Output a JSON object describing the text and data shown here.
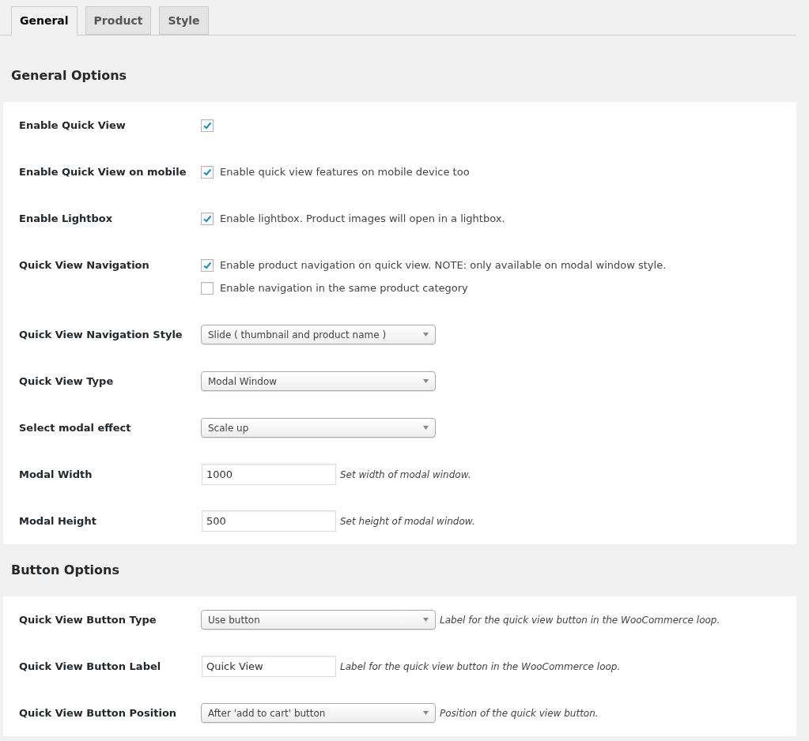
{
  "tabs": [
    {
      "label": "General",
      "selected": true
    },
    {
      "label": "Product",
      "selected": false
    },
    {
      "label": "Style",
      "selected": false
    }
  ],
  "sections": [
    {
      "title": "General Options",
      "rows": [
        {
          "label": "Enable Quick View",
          "kind": "checkboxes",
          "options": [
            {
              "checked": true
            }
          ]
        },
        {
          "label": "Enable Quick View on mobile",
          "kind": "checkboxes",
          "options": [
            {
              "text": "Enable quick view features on mobile device too",
              "checked": true
            }
          ]
        },
        {
          "label": "Enable Lightbox",
          "kind": "checkboxes",
          "options": [
            {
              "text": "Enable lightbox. Product images will open in a lightbox.",
              "checked": true
            }
          ]
        },
        {
          "label": "Quick View Navigation",
          "kind": "checkboxes",
          "options": [
            {
              "text": "Enable product navigation on quick view. NOTE: only available on modal window style.",
              "checked": true
            },
            {
              "text": "Enable navigation in the same product category",
              "checked": false
            }
          ]
        },
        {
          "label": "Quick View Navigation Style",
          "kind": "select",
          "value": "Slide ( thumbnail and product name )"
        },
        {
          "label": "Quick View Type",
          "kind": "select",
          "value": "Modal Window"
        },
        {
          "label": "Select modal effect",
          "kind": "select",
          "value": "Scale up"
        },
        {
          "label": "Modal Width",
          "kind": "text",
          "value": "1000",
          "description": "Set width of modal window."
        },
        {
          "label": "Modal Height",
          "kind": "text",
          "value": "500",
          "description": "Set height of modal window."
        }
      ]
    },
    {
      "title": "Button Options",
      "rows": [
        {
          "label": "Quick View Button Type",
          "kind": "select",
          "value": "Use button",
          "description": "Label for the quick view button in the WooCommerce loop."
        },
        {
          "label": "Quick View Button Label",
          "kind": "text",
          "value": "Quick View",
          "description": "Label for the quick view button in the WooCommerce loop."
        },
        {
          "label": "Quick View Button Position",
          "kind": "select",
          "value": "After 'add to cart' button",
          "description": "Position of the quick view button."
        }
      ]
    }
  ]
}
